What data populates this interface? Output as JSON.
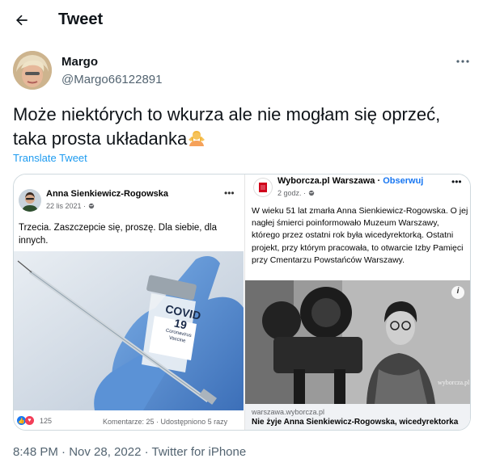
{
  "header": {
    "title": "Tweet",
    "back_icon": "arrow-left-icon"
  },
  "tweet": {
    "author_name": "Margo",
    "author_handle": "@Margo66122891",
    "text_line1": "Może niektórych to wkurza ale nie mogłam się oprzeć,",
    "text_line2": "taka prosta układanka",
    "emoji": "woman-shrugging-emoji",
    "translate_label": "Translate Tweet",
    "timestamp": "8:48 PM · Nov 28, 2022 · Twitter for iPhone"
  },
  "left_post": {
    "author": "Anna Sienkiewicz-Rogowska",
    "date": "22 lis 2021 · ",
    "text": "Trzecia. Zaszczepcie się, proszę. Dla siebie, dla innych.",
    "vial_line1": "COVID",
    "vial_line2": "19",
    "vial_line3": "Coronavirus",
    "vial_line4": "Vaccine",
    "reaction_count": "125",
    "stats": "Komentarze: 25 · Udostępniono 5 razy"
  },
  "right_post": {
    "page_name": "Wyborcza.pl Warszawa",
    "separator": " · ",
    "follow": "Obserwuj",
    "time": "2 godz. · ",
    "text": "W wieku 51 lat zmarła Anna Sienkiewicz-Rogowska. O jej nagłej śmierci poinformowało Muzeum Warszawy, którego przez ostatni rok była wicedyrektorką. Ostatni projekt, przy którym pracowała, to otwarcie Izby Pamięci przy Cmentarzu Powstańców Warszawy.",
    "watermark": "wyborcza.pl",
    "info": "i",
    "domain": "warszawa.wyborcza.pl",
    "headline": "Nie żyje Anna Sienkiewicz-Rogowska, wicedyrektorka"
  },
  "colors": {
    "link": "#1d9bf0",
    "secondary": "#536471",
    "fb_blue": "#1877f2"
  }
}
